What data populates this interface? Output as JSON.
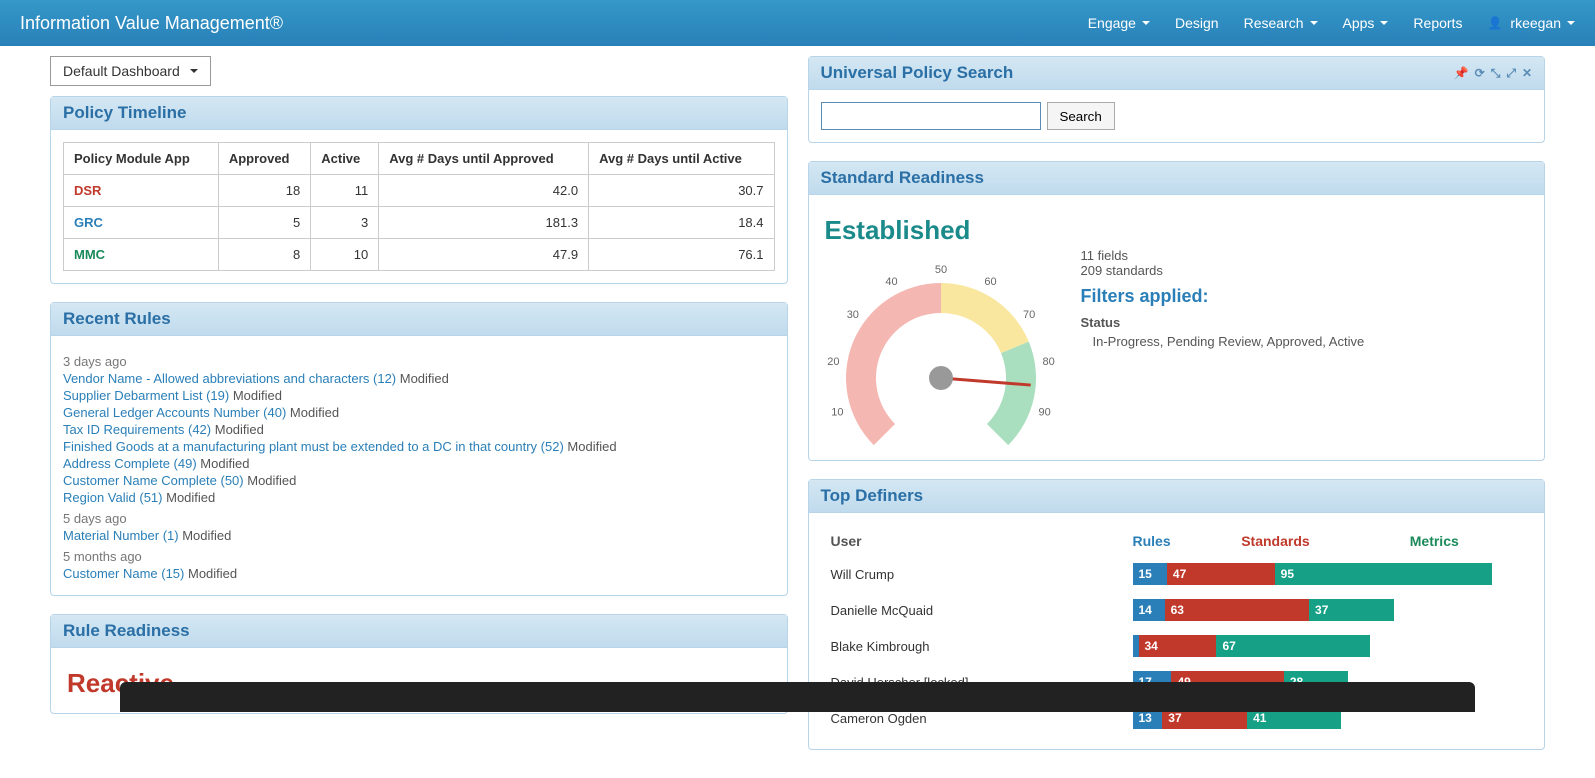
{
  "nav": {
    "brand": "Information Value Management®",
    "items": [
      "Engage",
      "Design",
      "Research",
      "Apps",
      "Reports"
    ],
    "dropdowns": [
      true,
      false,
      true,
      true,
      false
    ],
    "user": "rkeegan"
  },
  "dashboard_select": "Default Dashboard",
  "policy_timeline": {
    "title": "Policy Timeline",
    "headers": [
      "Policy Module App",
      "Approved",
      "Active",
      "Avg # Days until Approved",
      "Avg # Days until Active"
    ],
    "rows": [
      {
        "app": "DSR",
        "cls": "app-red",
        "approved": 18,
        "active": 11,
        "avg_approved": "42.0",
        "avg_active": "30.7"
      },
      {
        "app": "GRC",
        "cls": "app-blue",
        "approved": 5,
        "active": 3,
        "avg_approved": "181.3",
        "avg_active": "18.4"
      },
      {
        "app": "MMC",
        "cls": "app-green",
        "approved": 8,
        "active": 10,
        "avg_approved": "47.9",
        "avg_active": "76.1"
      }
    ]
  },
  "recent_rules": {
    "title": "Recent Rules",
    "groups": [
      {
        "time": "3 days ago",
        "rules": [
          {
            "name": "Vendor Name - Allowed abbreviations and characters (12)",
            "status": "Modified"
          },
          {
            "name": "Supplier Debarment List (19)",
            "status": "Modified"
          },
          {
            "name": "General Ledger Accounts Number (40)",
            "status": "Modified"
          },
          {
            "name": "Tax ID Requirements (42)",
            "status": "Modified"
          },
          {
            "name": "Finished Goods at a manufacturing plant must be extended to a DC in that country (52)",
            "status": "Modified"
          },
          {
            "name": "Address Complete (49)",
            "status": "Modified"
          },
          {
            "name": "Customer Name Complete (50)",
            "status": "Modified"
          },
          {
            "name": "Region Valid (51)",
            "status": "Modified"
          }
        ]
      },
      {
        "time": "5 days ago",
        "rules": [
          {
            "name": "Material Number (1)",
            "status": "Modified"
          }
        ]
      },
      {
        "time": "5 months ago",
        "rules": [
          {
            "name": "Customer Name (15)",
            "status": "Modified"
          }
        ]
      }
    ]
  },
  "rule_readiness": {
    "title": "Rule Readiness",
    "status": "Reactive"
  },
  "search": {
    "title": "Universal Policy Search",
    "button": "Search",
    "value": ""
  },
  "standard_readiness": {
    "title": "Standard Readiness",
    "status": "Established",
    "fields_count": "11 fields",
    "standards_count": "209 standards",
    "filters_title": "Filters applied:",
    "filter_label": "Status",
    "filter_values": "In-Progress, Pending Review, Approved, Active",
    "gauge_value": 85,
    "gauge_ticks": [
      0,
      10,
      20,
      30,
      40,
      50,
      60,
      70,
      80,
      90,
      100
    ]
  },
  "top_definers": {
    "title": "Top Definers",
    "headers": {
      "user": "User",
      "rules": "Rules",
      "standards": "Standards",
      "metrics": "Metrics"
    },
    "rows": [
      {
        "user": "Will Crump",
        "rules": 15,
        "standards": 47,
        "metrics": 95
      },
      {
        "user": "Danielle McQuaid",
        "rules": 14,
        "standards": 63,
        "metrics": 37
      },
      {
        "user": "Blake Kimbrough",
        "rules": 1,
        "standards": 34,
        "metrics": 67
      },
      {
        "user": "David Herscher [locked]",
        "rules": 17,
        "standards": 49,
        "metrics": 28
      },
      {
        "user": "Cameron Ogden",
        "rules": 13,
        "standards": 37,
        "metrics": 41
      }
    ]
  },
  "chart_data": {
    "type": "bar",
    "title": "Top Definers",
    "categories": [
      "Will Crump",
      "Danielle McQuaid",
      "Blake Kimbrough",
      "David Herscher [locked]",
      "Cameron Ogden"
    ],
    "series": [
      {
        "name": "Rules",
        "values": [
          15,
          14,
          1,
          17,
          13
        ]
      },
      {
        "name": "Standards",
        "values": [
          47,
          63,
          34,
          49,
          37
        ]
      },
      {
        "name": "Metrics",
        "values": [
          95,
          37,
          67,
          28,
          41
        ]
      }
    ]
  }
}
